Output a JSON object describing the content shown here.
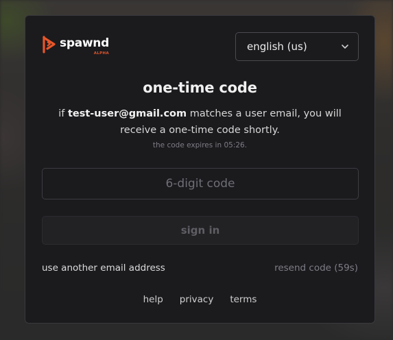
{
  "brand": {
    "name": "spawnd",
    "tag": "ALPHA",
    "accent_color": "#e8562a",
    "logo_icon": "spawnd-logo-icon"
  },
  "language_select": {
    "value": "english (us)",
    "icon": "chevron-down-icon"
  },
  "auth": {
    "title": "one-time code",
    "message_prefix": "if ",
    "email": "test-user@gmail.com",
    "message_suffix": " matches a user email, you will receive a one-time code shortly.",
    "expiry_text": "the code expires in 05:26.",
    "code_placeholder": "6-digit code",
    "code_value": "",
    "signin_label": "sign in",
    "another_email_label": "use another email address",
    "resend_label": "resend code (59s)"
  },
  "footer": {
    "help": "help",
    "privacy": "privacy",
    "terms": "terms"
  },
  "colors": {
    "card_background": "#1b1b1e",
    "border": "#3a3a3f",
    "muted_text": "#7d7d85"
  }
}
